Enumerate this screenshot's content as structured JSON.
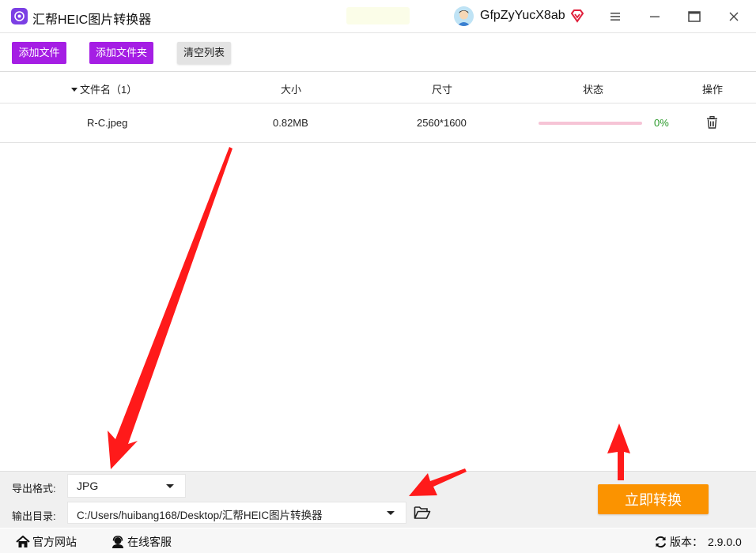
{
  "app": {
    "title": "汇帮HEIC图片转换器",
    "username": "GfpZyYucX8ab",
    "brand_color": "#a51ee4",
    "accent_color": "#fb9300"
  },
  "window_controls": {
    "icons": [
      "menu-icon",
      "minimize-icon",
      "maximize-icon",
      "close-icon"
    ]
  },
  "toolbar": {
    "add_file_label": "添加文件",
    "add_folder_label": "添加文件夹",
    "clear_label": "清空列表"
  },
  "table": {
    "columns": {
      "name": "文件名（1）",
      "size": "大小",
      "dimensions": "尺寸",
      "status": "状态",
      "action": "操作"
    },
    "rows": [
      {
        "name": "R-C.jpeg",
        "size": "0.82MB",
        "dimensions": "2560*1600",
        "progress_percent": 0,
        "progress_text": "0%",
        "action_icon": "trash-icon"
      }
    ]
  },
  "settings": {
    "format_label": "导出格式:",
    "format_value": "JPG",
    "output_dir_label": "输出目录:",
    "output_dir_value": "C:/Users/huibang168/Desktop/汇帮HEIC图片转换器",
    "folder_icon": "folder-open-icon",
    "convert_label": "立即转换"
  },
  "statusbar": {
    "site_label": "官方网站",
    "service_label": "在线客服",
    "version_label": "版本：",
    "version_value": "2.9.0.0"
  },
  "annotations": {
    "arrow_color": "#ff1a1a"
  }
}
